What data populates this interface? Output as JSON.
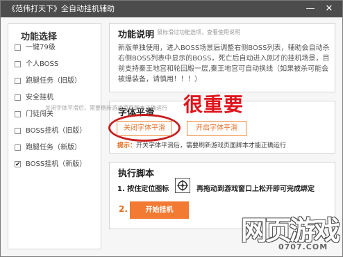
{
  "window": {
    "title": "《范伟打天下》全自动挂机辅助",
    "minimize_glyph": "—",
    "close_glyph": "✕"
  },
  "left_panel": {
    "heading": "功能选择",
    "items": [
      {
        "label": "一键79级",
        "checked": false
      },
      {
        "label": "个人BOSS",
        "checked": false
      },
      {
        "label": "跑腿任务（旧版）",
        "checked": false
      },
      {
        "label": "安全挂机",
        "checked": false
      },
      {
        "label": "门徒闯关",
        "checked": false
      },
      {
        "label": "BOSS挂机（旧版）",
        "checked": false
      },
      {
        "label": "跑腿任务（新版）",
        "checked": false
      },
      {
        "label": "BOSS挂机（新版）",
        "checked": true
      }
    ]
  },
  "description": {
    "heading": "功能说明",
    "subheading": "鼠标滑过功能选项，查看使用说明",
    "text": "新版单独使用，进入BOSS场景后调整右侧BOSS列表，辅助会自动杀右侧BOSS列表中显示的BOSS，死亡后自动进入刚才的挂机场景，目前支持秦王地宫和轮回殿一层,秦王地宫可自动换线（如果被杀可能会被爆装备，请慎用！！！）"
  },
  "font_smoothing": {
    "heading": "字体平滑",
    "faint_hint": "关闭字体平滑后，需要刷新游戏页面脚本正确运行",
    "emphasis_text": "很重要",
    "disable_label": "关闭字体平滑",
    "enable_label": "开启字体平滑",
    "note_prefix": "提示：",
    "note_text": "开关字体平滑后，需要刷新游戏页面脚本才能正确运行"
  },
  "run_script": {
    "heading": "执行脚本",
    "step1_part1": "1. 按住定位图标",
    "step1_part2": "再拖动到游戏窗口上松开即可完成绑定",
    "step2_number": "2.",
    "start_label": "开始挂机"
  },
  "watermark": {
    "main": "网页游戏",
    "sub": "0707.COM"
  },
  "colors": {
    "accent_orange": "#f27a32",
    "emphasis_red": "#e0141c",
    "titlebar": "#4c4c4c"
  }
}
